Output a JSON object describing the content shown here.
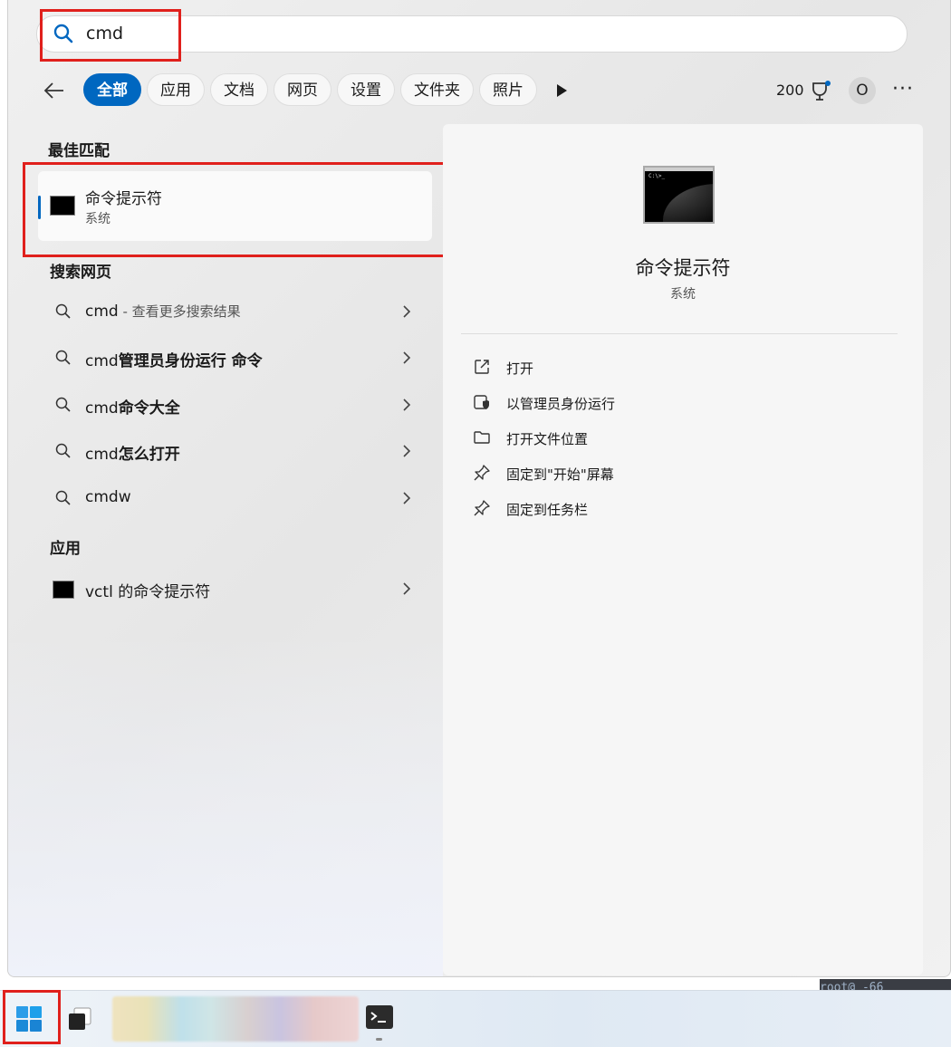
{
  "search": {
    "query": "cmd"
  },
  "filters": {
    "tabs": [
      {
        "label": "全部",
        "active": true
      },
      {
        "label": "应用",
        "active": false
      },
      {
        "label": "文档",
        "active": false
      },
      {
        "label": "网页",
        "active": false
      },
      {
        "label": "设置",
        "active": false
      },
      {
        "label": "文件夹",
        "active": false
      },
      {
        "label": "照片",
        "active": false
      }
    ],
    "points": "200",
    "avatar_letter": "O",
    "more_label": "···"
  },
  "best_match": {
    "heading": "最佳匹配",
    "name": "命令提示符",
    "type": "系统"
  },
  "web": {
    "heading": "搜索网页",
    "rows": [
      {
        "prefix": "cmd",
        "bold": "",
        "hint": " - 查看更多搜索结果"
      },
      {
        "prefix": "cmd",
        "bold": "管理员身份运行 命令",
        "hint": ""
      },
      {
        "prefix": "cmd",
        "bold": "命令大全",
        "hint": ""
      },
      {
        "prefix": "cmd",
        "bold": "怎么打开",
        "hint": ""
      },
      {
        "prefix": "cmdw",
        "bold": "",
        "hint": ""
      }
    ]
  },
  "apps": {
    "heading": "应用",
    "items": [
      {
        "label": "vctl 的命令提示符"
      }
    ]
  },
  "preview": {
    "title": "命令提示符",
    "subtitle": "系统",
    "actions": [
      {
        "label": "打开",
        "icon": "open-external-icon"
      },
      {
        "label": "以管理员身份运行",
        "icon": "shield-admin-icon"
      },
      {
        "label": "打开文件位置",
        "icon": "folder-icon"
      },
      {
        "label": "固定到\"开始\"屏幕",
        "icon": "pin-icon"
      },
      {
        "label": "固定到任务栏",
        "icon": "pin-icon"
      }
    ]
  },
  "taskbar": {
    "terminal_strip_text": "root@         -66"
  },
  "colors": {
    "accent": "#0067c0",
    "highlight": "#e0201c"
  }
}
